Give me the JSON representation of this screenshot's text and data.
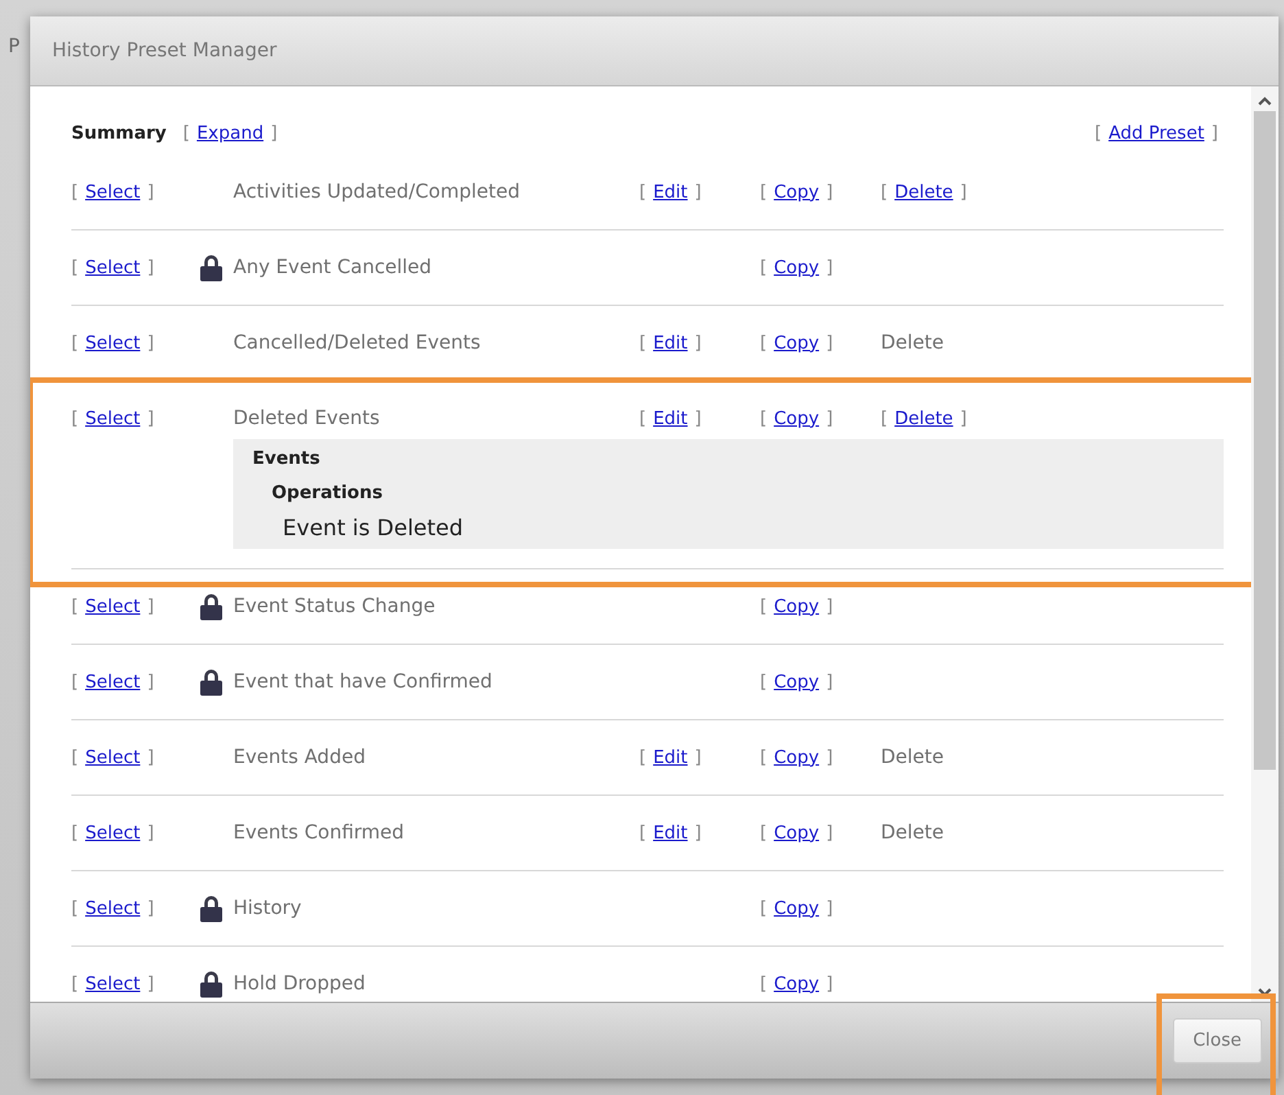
{
  "background_fragment": "P",
  "dialog": {
    "title": "History Preset Manager"
  },
  "summary": {
    "label": "Summary",
    "expand": {
      "before": "[",
      "label": "Expand",
      "after": "]"
    },
    "add": {
      "before": "[",
      "label": "Add Preset",
      "after": "]"
    }
  },
  "presets": [
    {
      "name": "Activities Updated/Completed",
      "locked": false,
      "highlighted": false,
      "select": {
        "kind": "link",
        "before": "[",
        "label": "Select",
        "after": "]"
      },
      "edit": {
        "kind": "link",
        "before": "[",
        "label": "Edit",
        "after": "]"
      },
      "copy": {
        "kind": "link",
        "before": "[",
        "label": "Copy",
        "after": "]"
      },
      "delete": {
        "kind": "link",
        "before": "[",
        "label": "Delete",
        "after": "]"
      }
    },
    {
      "name": "Any Event Cancelled",
      "locked": true,
      "highlighted": false,
      "select": {
        "kind": "link",
        "before": "[",
        "label": "Select",
        "after": "]"
      },
      "copy": {
        "kind": "link",
        "before": "[",
        "label": "Copy",
        "after": "]"
      }
    },
    {
      "name": "Cancelled/Deleted Events",
      "locked": false,
      "highlighted": false,
      "select": {
        "kind": "link",
        "before": "[",
        "label": "Select",
        "after": "]"
      },
      "edit": {
        "kind": "link",
        "before": "[",
        "label": "Edit",
        "after": "]"
      },
      "copy": {
        "kind": "link",
        "before": "[",
        "label": "Copy",
        "after": "]"
      },
      "delete": {
        "kind": "plain",
        "label": "Delete"
      }
    },
    {
      "name": "Deleted Events",
      "locked": false,
      "highlighted": true,
      "select": {
        "kind": "link",
        "before": "[",
        "label": "Select",
        "after": "]"
      },
      "edit": {
        "kind": "link",
        "before": "[",
        "label": "Edit",
        "after": "]"
      },
      "copy": {
        "kind": "link",
        "before": "[",
        "label": "Copy",
        "after": "]"
      },
      "delete": {
        "kind": "link",
        "before": "[",
        "label": "Delete",
        "after": "]"
      },
      "details": [
        {
          "kind": "group",
          "text": "Events"
        },
        {
          "kind": "subgroup",
          "text": "Operations"
        },
        {
          "kind": "condition",
          "text": "Event is Deleted"
        }
      ]
    },
    {
      "name": "Event Status Change",
      "locked": true,
      "highlighted": false,
      "select": {
        "kind": "link",
        "before": "[",
        "label": "Select",
        "after": "]"
      },
      "copy": {
        "kind": "link",
        "before": "[",
        "label": "Copy",
        "after": "]"
      }
    },
    {
      "name": "Event that have Confirmed",
      "locked": true,
      "highlighted": false,
      "select": {
        "kind": "link",
        "before": "[",
        "label": "Select",
        "after": "]"
      },
      "copy": {
        "kind": "link",
        "before": "[",
        "label": "Copy",
        "after": "]"
      }
    },
    {
      "name": "Events Added",
      "locked": false,
      "highlighted": false,
      "select": {
        "kind": "link",
        "before": "[",
        "label": "Select",
        "after": "]"
      },
      "edit": {
        "kind": "link",
        "before": "[",
        "label": "Edit",
        "after": "]"
      },
      "copy": {
        "kind": "link",
        "before": "[",
        "label": "Copy",
        "after": "]"
      },
      "delete": {
        "kind": "plain",
        "label": "Delete"
      }
    },
    {
      "name": "Events Confirmed",
      "locked": false,
      "highlighted": false,
      "select": {
        "kind": "link",
        "before": "[",
        "label": "Select",
        "after": "]"
      },
      "edit": {
        "kind": "link",
        "before": "[",
        "label": "Edit",
        "after": "]"
      },
      "copy": {
        "kind": "link",
        "before": "[",
        "label": "Copy",
        "after": "]"
      },
      "delete": {
        "kind": "plain",
        "label": "Delete"
      }
    },
    {
      "name": "History",
      "locked": true,
      "highlighted": false,
      "select": {
        "kind": "link",
        "before": "[",
        "label": "Select",
        "after": "]"
      },
      "copy": {
        "kind": "link",
        "before": "[",
        "label": "Copy",
        "after": "]"
      }
    },
    {
      "name": "Hold Dropped",
      "locked": true,
      "highlighted": false,
      "select": {
        "kind": "link",
        "before": "[",
        "label": "Select",
        "after": "]"
      },
      "copy": {
        "kind": "link",
        "before": "[",
        "label": "Copy",
        "after": "]"
      }
    }
  ],
  "close_button": {
    "label": "Close",
    "highlighted": true
  }
}
